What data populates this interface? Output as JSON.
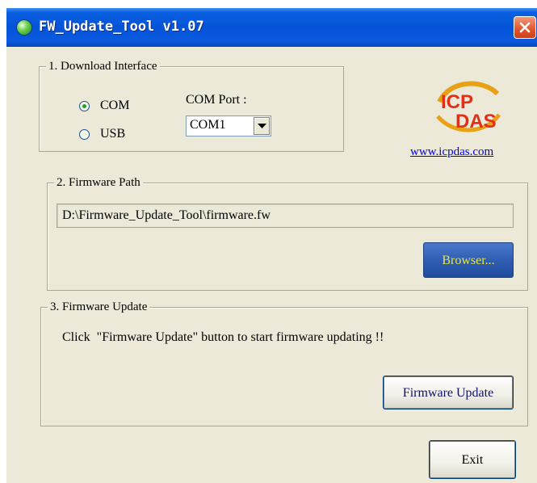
{
  "window": {
    "title": "FW_Update_Tool v1.07"
  },
  "download_interface": {
    "legend": "1. Download Interface",
    "com_label": "COM",
    "usb_label": "USB",
    "selected": "COM",
    "com_port_label": "COM Port :",
    "com_port_value": "COM1"
  },
  "branding": {
    "logo_text": "ICP DAS",
    "link_text": "www.icpdas.com"
  },
  "firmware_path": {
    "legend": "2. Firmware Path",
    "path_value": "D:\\Firmware_Update_Tool\\firmware.fw",
    "browse_label": "Browser..."
  },
  "firmware_update": {
    "legend": "3. Firmware Update",
    "instruction": "Click  \"Firmware Update\" button to start firmware updating !!",
    "update_label": "Firmware Update"
  },
  "footer": {
    "exit_label": "Exit"
  },
  "colors": {
    "titlebar": "#0553d8",
    "dialog_bg": "#ece9d8",
    "browse_button": "#2d5bb0",
    "browse_text": "#e6e64a",
    "link": "#0000ee",
    "close_button": "#e2542b"
  }
}
